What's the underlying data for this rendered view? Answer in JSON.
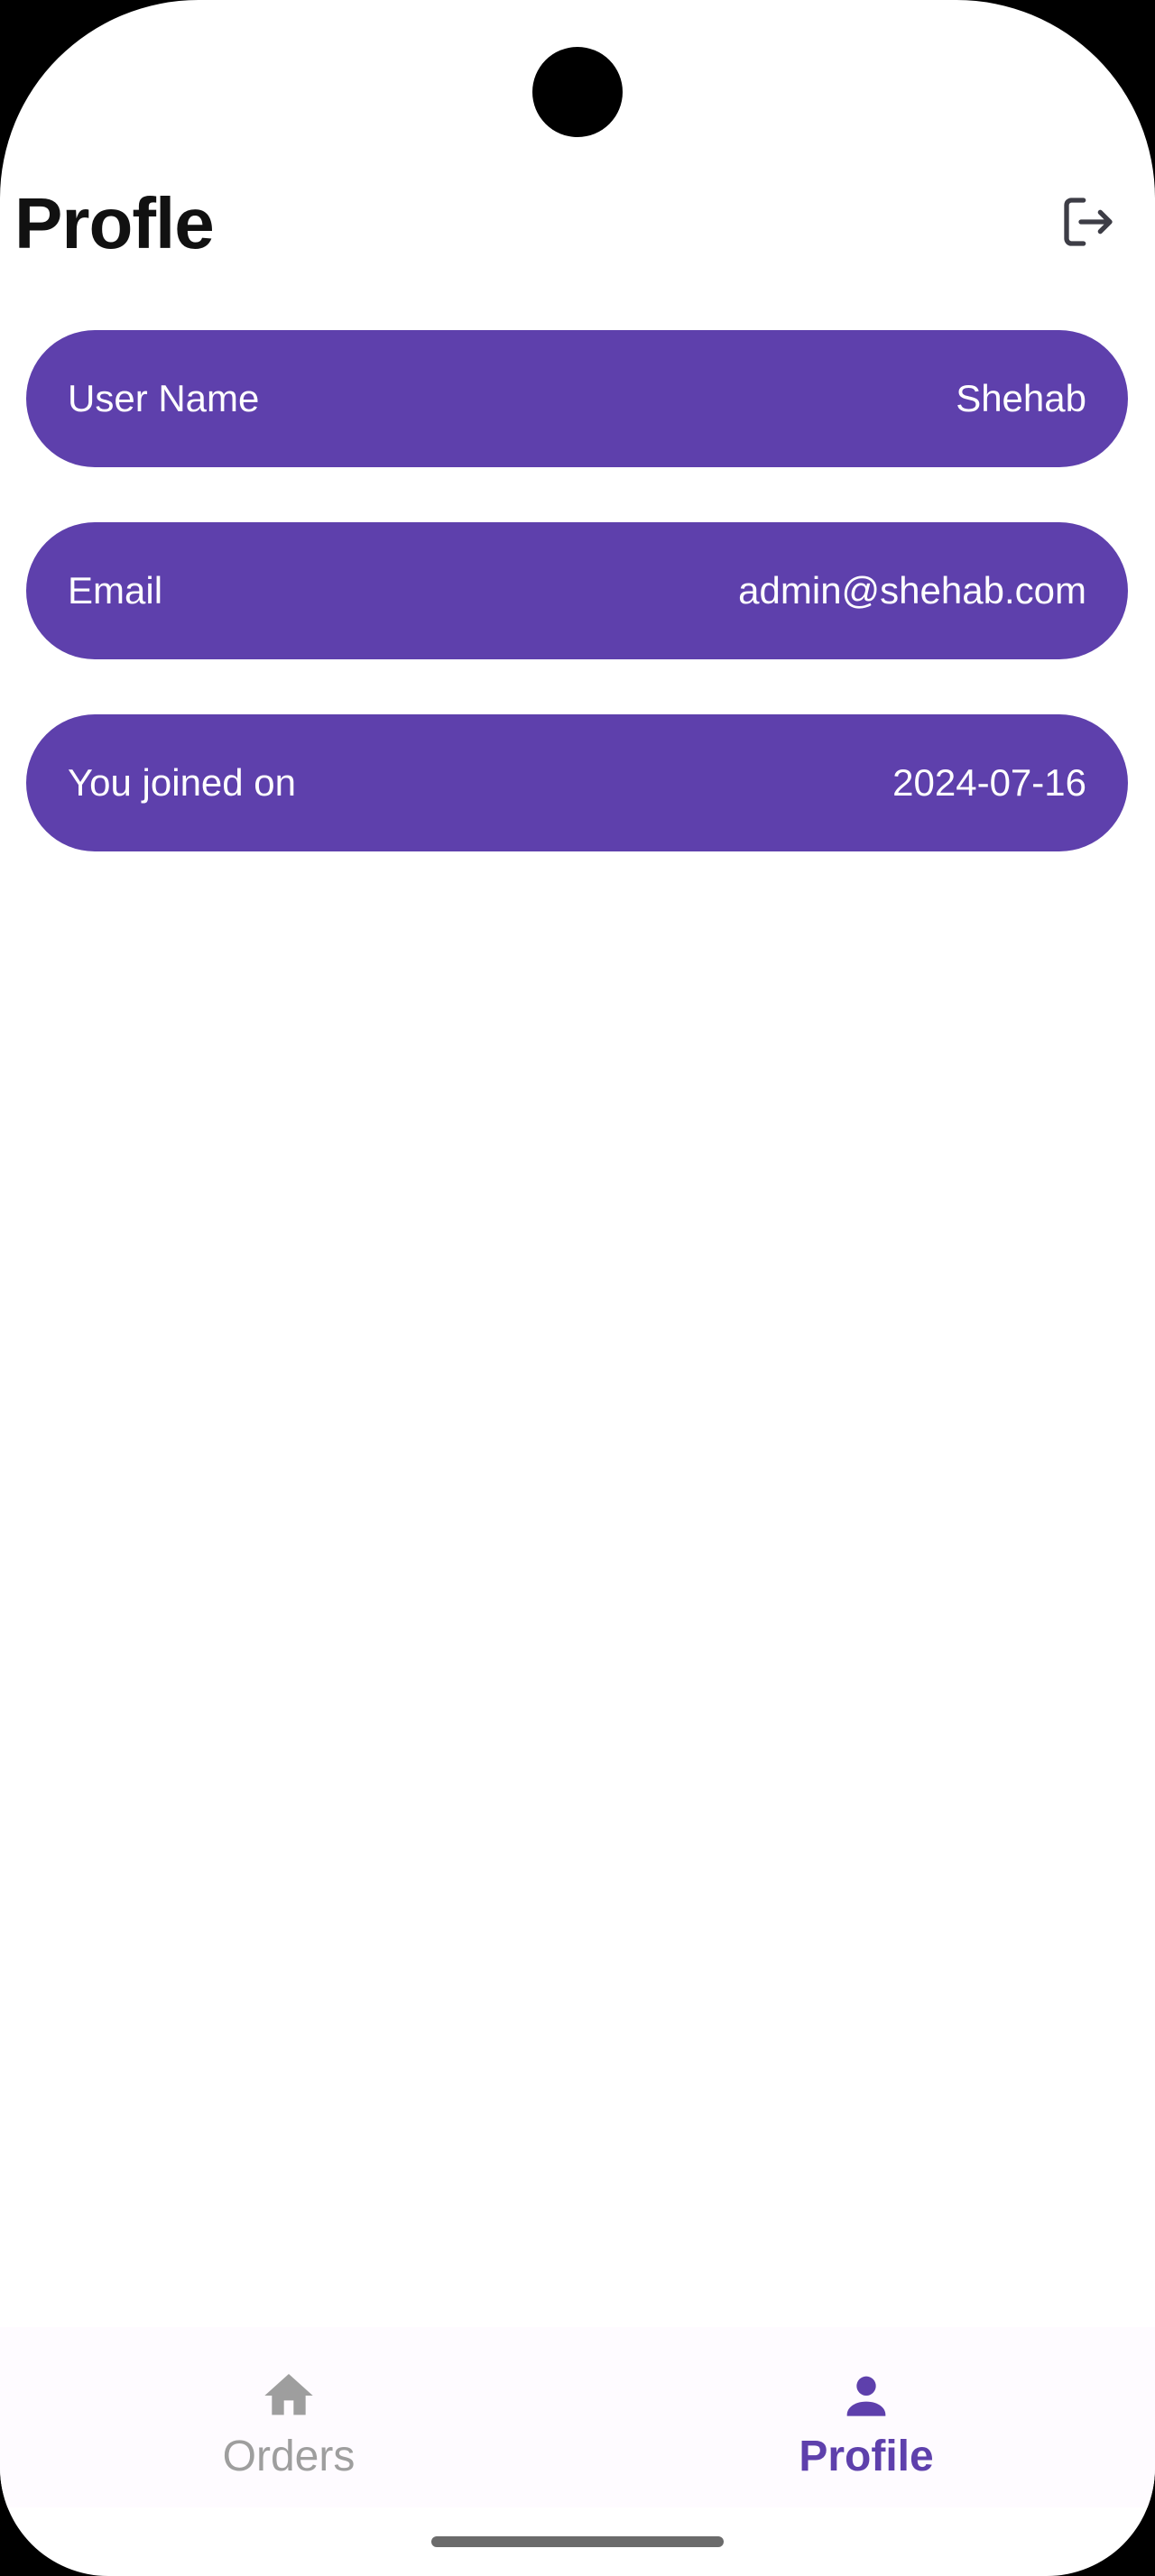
{
  "app": {
    "title": "Profle",
    "accent_color": "#5e40ac",
    "inactive_color": "#9e9e9e"
  },
  "header": {
    "logout_icon": "logout-icon"
  },
  "profile": {
    "items": [
      {
        "label": "User Name",
        "value": "Shehab"
      },
      {
        "label": "Email",
        "value": "admin@shehab.com"
      },
      {
        "label": "You joined on",
        "value": "2024-07-16"
      }
    ]
  },
  "bottom_nav": {
    "items": [
      {
        "label": "Orders",
        "icon": "home-icon",
        "active": false
      },
      {
        "label": "Profile",
        "icon": "person-icon",
        "active": true
      }
    ]
  }
}
